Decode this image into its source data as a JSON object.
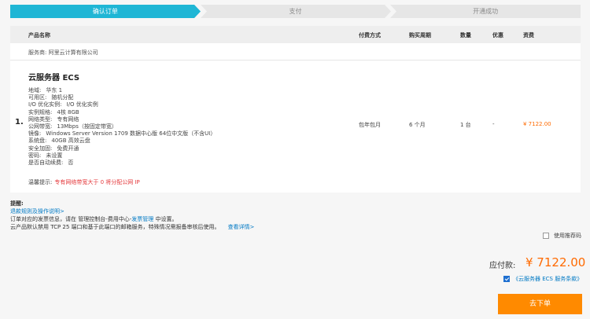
{
  "steps": [
    {
      "label": "确认订单",
      "active": true
    },
    {
      "label": "支付",
      "active": false
    },
    {
      "label": "开通成功",
      "active": false
    }
  ],
  "colors": {
    "accent": "#1fb6d5",
    "price": "#ff6a00",
    "button": "#ff8a00",
    "warning": "#e4393c",
    "link": "#0079c4"
  },
  "table": {
    "headers": {
      "product": "产品名称",
      "payment": "付费方式",
      "period": "购买周期",
      "quantity": "数量",
      "discount": "优惠",
      "price": "资费"
    },
    "provider": "服务商: 阿里云计算有限公司",
    "row": {
      "index": "1.",
      "title": "云服务器 ECS",
      "specs": [
        {
          "key": "地域:",
          "value": "华东 1"
        },
        {
          "key": "可用区:",
          "value": "随机分配"
        },
        {
          "key": "I/O 优化实例:",
          "value": "I/O 优化实例"
        },
        {
          "key": "实例规格:",
          "value": "4核 8GB"
        },
        {
          "key": "网络类型:",
          "value": "专有网络"
        },
        {
          "key": "公网带宽:",
          "value": "13Mbps（按固定带宽）"
        },
        {
          "key": "镜像:",
          "value": "Windows Server Version 1709 数据中心版 64位中文版（不含UI）"
        },
        {
          "key": "系统盘:",
          "value": "40GB 高效云盘"
        },
        {
          "key": "安全加固:",
          "value": "免费开通"
        },
        {
          "key": "密码:",
          "value": "未设置"
        },
        {
          "key": "是否自动续费:",
          "value": "否"
        }
      ],
      "tip_label": "温馨提示:",
      "tip_text": "专有网络带宽大于 0 将分配公网 IP",
      "payment": "包年包月",
      "period": "6 个月",
      "quantity": "1 台",
      "discount": "-",
      "price": "¥ 7122.00"
    }
  },
  "notes": {
    "title": "提醒:",
    "refund_link": "退款规则及操作说明>",
    "invoice_prefix": "订单对应的发票信息，请在 管理控制台-费用中心-",
    "invoice_link": "发票管理",
    "invoice_suffix": " 中设置。",
    "port_text": "云产品默认禁用 TCP 25 端口和基于此端口的邮箱服务，特殊情况需报备审核后使用。",
    "port_link": "查看详情>"
  },
  "coupon_label": "使用推荐码",
  "total": {
    "label": "应付款:",
    "value": "¥ 7122.00"
  },
  "agreement": "《云服务器 ECS 服务条款》",
  "submit_label": "去下单"
}
